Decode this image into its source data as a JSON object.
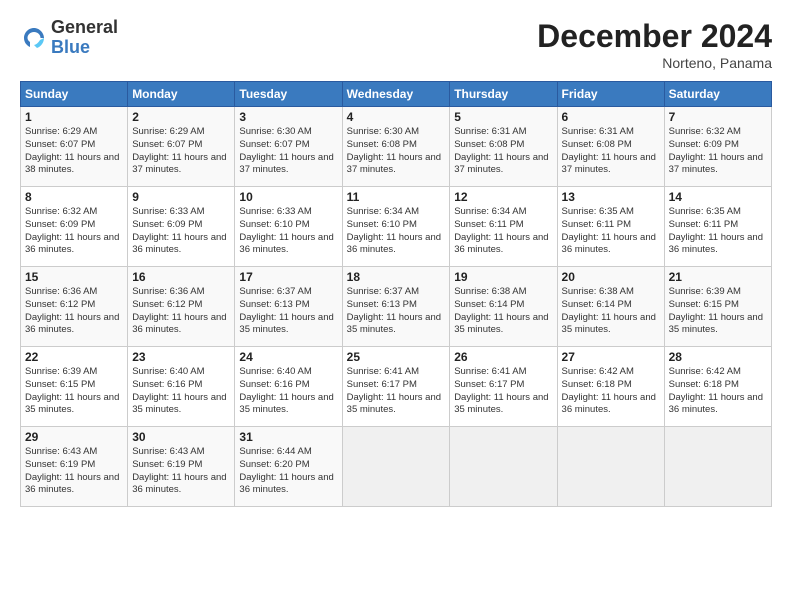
{
  "header": {
    "logo_general": "General",
    "logo_blue": "Blue",
    "month_title": "December 2024",
    "location": "Norteno, Panama"
  },
  "days_of_week": [
    "Sunday",
    "Monday",
    "Tuesday",
    "Wednesday",
    "Thursday",
    "Friday",
    "Saturday"
  ],
  "weeks": [
    [
      {
        "day": "1",
        "sunrise": "6:29 AM",
        "sunset": "6:07 PM",
        "daylight": "11 hours and 38 minutes."
      },
      {
        "day": "2",
        "sunrise": "6:29 AM",
        "sunset": "6:07 PM",
        "daylight": "11 hours and 37 minutes."
      },
      {
        "day": "3",
        "sunrise": "6:30 AM",
        "sunset": "6:07 PM",
        "daylight": "11 hours and 37 minutes."
      },
      {
        "day": "4",
        "sunrise": "6:30 AM",
        "sunset": "6:08 PM",
        "daylight": "11 hours and 37 minutes."
      },
      {
        "day": "5",
        "sunrise": "6:31 AM",
        "sunset": "6:08 PM",
        "daylight": "11 hours and 37 minutes."
      },
      {
        "day": "6",
        "sunrise": "6:31 AM",
        "sunset": "6:08 PM",
        "daylight": "11 hours and 37 minutes."
      },
      {
        "day": "7",
        "sunrise": "6:32 AM",
        "sunset": "6:09 PM",
        "daylight": "11 hours and 37 minutes."
      }
    ],
    [
      {
        "day": "8",
        "sunrise": "6:32 AM",
        "sunset": "6:09 PM",
        "daylight": "11 hours and 36 minutes."
      },
      {
        "day": "9",
        "sunrise": "6:33 AM",
        "sunset": "6:09 PM",
        "daylight": "11 hours and 36 minutes."
      },
      {
        "day": "10",
        "sunrise": "6:33 AM",
        "sunset": "6:10 PM",
        "daylight": "11 hours and 36 minutes."
      },
      {
        "day": "11",
        "sunrise": "6:34 AM",
        "sunset": "6:10 PM",
        "daylight": "11 hours and 36 minutes."
      },
      {
        "day": "12",
        "sunrise": "6:34 AM",
        "sunset": "6:11 PM",
        "daylight": "11 hours and 36 minutes."
      },
      {
        "day": "13",
        "sunrise": "6:35 AM",
        "sunset": "6:11 PM",
        "daylight": "11 hours and 36 minutes."
      },
      {
        "day": "14",
        "sunrise": "6:35 AM",
        "sunset": "6:11 PM",
        "daylight": "11 hours and 36 minutes."
      }
    ],
    [
      {
        "day": "15",
        "sunrise": "6:36 AM",
        "sunset": "6:12 PM",
        "daylight": "11 hours and 36 minutes."
      },
      {
        "day": "16",
        "sunrise": "6:36 AM",
        "sunset": "6:12 PM",
        "daylight": "11 hours and 36 minutes."
      },
      {
        "day": "17",
        "sunrise": "6:37 AM",
        "sunset": "6:13 PM",
        "daylight": "11 hours and 35 minutes."
      },
      {
        "day": "18",
        "sunrise": "6:37 AM",
        "sunset": "6:13 PM",
        "daylight": "11 hours and 35 minutes."
      },
      {
        "day": "19",
        "sunrise": "6:38 AM",
        "sunset": "6:14 PM",
        "daylight": "11 hours and 35 minutes."
      },
      {
        "day": "20",
        "sunrise": "6:38 AM",
        "sunset": "6:14 PM",
        "daylight": "11 hours and 35 minutes."
      },
      {
        "day": "21",
        "sunrise": "6:39 AM",
        "sunset": "6:15 PM",
        "daylight": "11 hours and 35 minutes."
      }
    ],
    [
      {
        "day": "22",
        "sunrise": "6:39 AM",
        "sunset": "6:15 PM",
        "daylight": "11 hours and 35 minutes."
      },
      {
        "day": "23",
        "sunrise": "6:40 AM",
        "sunset": "6:16 PM",
        "daylight": "11 hours and 35 minutes."
      },
      {
        "day": "24",
        "sunrise": "6:40 AM",
        "sunset": "6:16 PM",
        "daylight": "11 hours and 35 minutes."
      },
      {
        "day": "25",
        "sunrise": "6:41 AM",
        "sunset": "6:17 PM",
        "daylight": "11 hours and 35 minutes."
      },
      {
        "day": "26",
        "sunrise": "6:41 AM",
        "sunset": "6:17 PM",
        "daylight": "11 hours and 35 minutes."
      },
      {
        "day": "27",
        "sunrise": "6:42 AM",
        "sunset": "6:18 PM",
        "daylight": "11 hours and 36 minutes."
      },
      {
        "day": "28",
        "sunrise": "6:42 AM",
        "sunset": "6:18 PM",
        "daylight": "11 hours and 36 minutes."
      }
    ],
    [
      {
        "day": "29",
        "sunrise": "6:43 AM",
        "sunset": "6:19 PM",
        "daylight": "11 hours and 36 minutes."
      },
      {
        "day": "30",
        "sunrise": "6:43 AM",
        "sunset": "6:19 PM",
        "daylight": "11 hours and 36 minutes."
      },
      {
        "day": "31",
        "sunrise": "6:44 AM",
        "sunset": "6:20 PM",
        "daylight": "11 hours and 36 minutes."
      },
      null,
      null,
      null,
      null
    ]
  ]
}
